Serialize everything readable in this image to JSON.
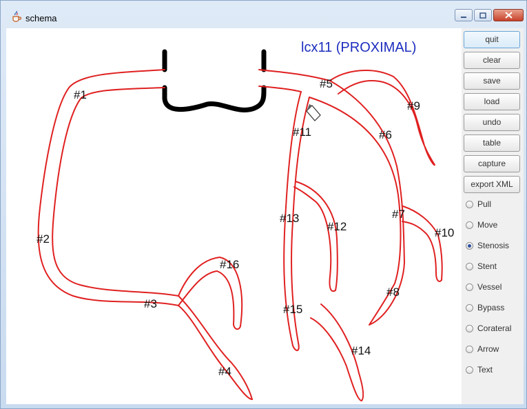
{
  "window": {
    "title": "schema",
    "icon": "java-cup-icon"
  },
  "canvas": {
    "heading": "lcx11 (PROXIMAL)",
    "heading_color": "#1c2dbe",
    "vessel_color": "#e02020",
    "segment_labels": [
      "#1",
      "#2",
      "#3",
      "#4",
      "#5",
      "#6",
      "#7",
      "#8",
      "#9",
      "#10",
      "#11",
      "#12",
      "#13",
      "#14",
      "#15",
      "#16"
    ]
  },
  "sidebar": {
    "buttons": [
      "quit",
      "clear",
      "save",
      "load",
      "undo",
      "table",
      "capture",
      "export XML"
    ],
    "modes": [
      "Pull",
      "Move",
      "Stenosis",
      "Stent",
      "Vessel",
      "Bypass",
      "Corateral",
      "Arrow",
      "Text"
    ],
    "selected_mode": "Stenosis"
  }
}
